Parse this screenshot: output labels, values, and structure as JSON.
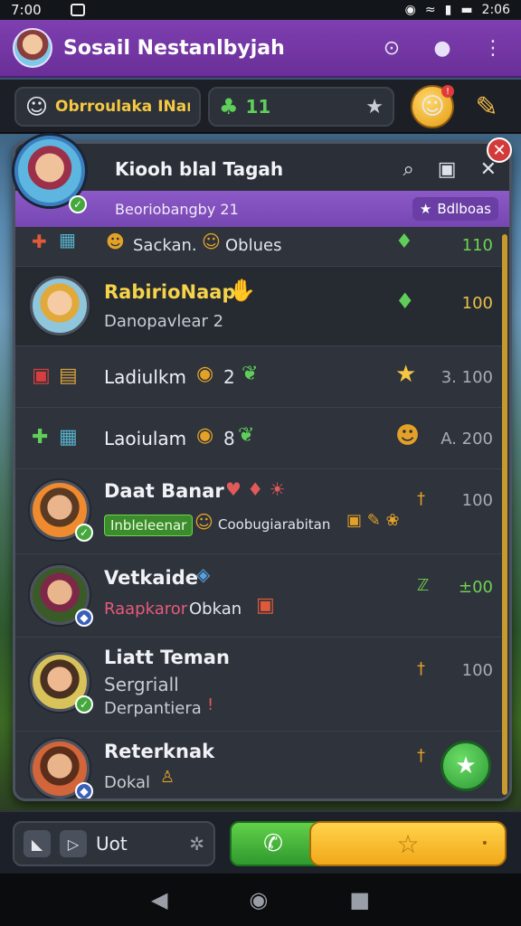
{
  "status": {
    "time": "7:00",
    "clock_right": "2:06"
  },
  "app": {
    "title": "Sosail Nestanlbyjah"
  },
  "resources": {
    "chip1_text": "Obrroulaka INant",
    "chip2_text": "11"
  },
  "panel": {
    "title": "Kiooh blal Tagah",
    "subtitle": "Beoriobangby 21",
    "filter_label": "Bdlboas"
  },
  "rows": [
    {
      "name": "Sackan.",
      "sub": "Oblues",
      "value": "110",
      "value_green": true
    },
    {
      "name": "RabirioNaap",
      "sub": "Danopavlear 2",
      "value": "100",
      "value_green": false
    },
    {
      "name": "Ladiulkm",
      "sub": "2",
      "value": "3.  100",
      "value_green": false
    },
    {
      "name": "Laoiulam",
      "sub": "8",
      "value": "A.  200",
      "value_green": false
    },
    {
      "name": "Daat Banar",
      "sub": "Coobugiarabitan",
      "tag": "Inbleleenar",
      "value": "100",
      "value_green": false
    },
    {
      "name": "Vetkaide",
      "sub": "Obkan",
      "tag": "Raapkaror",
      "value": "±00",
      "value_green": true
    },
    {
      "name": "Liatt Teman",
      "sub": "Sergriall",
      "sub2": "Derpantiera",
      "value": "100",
      "value_green": false
    },
    {
      "name": "Reterknak",
      "sub": "Dokal",
      "value": "",
      "value_green": false
    }
  ],
  "bottom": {
    "left_label": "Uot"
  },
  "colors": {
    "accent": "#7e3fb0",
    "gold": "#f5c842",
    "green": "#44a83d"
  }
}
